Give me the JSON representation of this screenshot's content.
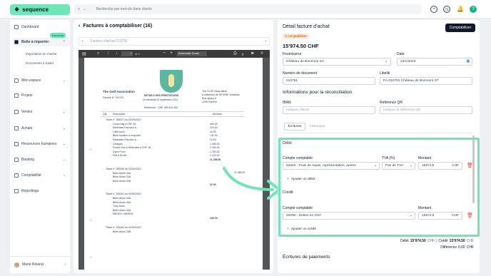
{
  "topbar": {
    "brand": "sequence",
    "search_placeholder": "Recherche par mot-clé dans clients"
  },
  "sidebar": {
    "items": [
      {
        "label": "Dashboard"
      },
      {
        "label": "Boîte à importer"
      },
      {
        "label": "Mon espace"
      },
      {
        "label": "Projets"
      },
      {
        "label": "Ventes"
      },
      {
        "label": "Achats"
      },
      {
        "label": "Ressources humaines"
      },
      {
        "label": "Banking"
      },
      {
        "label": "Comptabilité"
      },
      {
        "label": "Reportings"
      }
    ],
    "badge": "Nouveau",
    "subitems": [
      "Importation en masse",
      "Documents à traiter"
    ],
    "user": "Marie Roland"
  },
  "middle": {
    "title": "Factures à comptabiliser (16)",
    "file_selector": "Facture d'achat 010791",
    "toolbar": {
      "page": "1",
      "of": "of 2",
      "zoom": "Automatic Zoom"
    },
    "pdf": {
      "from": "The Golf Association",
      "invoice": "Facture N° 010791",
      "details_title": "DETAILS DES PRESTATIONS",
      "details_date": "Le vendredi 02 septembre 2022",
      "reference": "Référence : CHE-396.324.352",
      "to_lines": [
        "The GLOF Association",
        "A l'attention de SPORRI Jonathan",
        "Rue Appuy 6",
        "1208 Genève"
      ],
      "cols": [
        "Qte",
        "Description",
        "Montant"
      ],
      "rows": [
        {
          "desc": "Ticket n° 283371 du 02/09/2022",
          "amount": ""
        },
        {
          "desc": "Lunch bag à CHF 45",
          "amount": "450.00"
        },
        {
          "desc": "Minérales Pannaux à ...",
          "amount": "224.00"
        },
        {
          "desc": "Café lunch",
          "amount": "16.00"
        },
        {
          "desc": "Bière location à emporter",
          "amount": "132.00"
        },
        {
          "desc": "Minérales Pannaux à ...",
          "amount": "12.00"
        },
        {
          "desc": "Canapés",
          "amount": "1 080.00"
        },
        {
          "desc": "Forfait Vins & Minérales à CHF 18...",
          "amount": "1 260.00"
        },
        {
          "desc": "Open Food",
          "amount": "1 260.00"
        },
        {
          "desc": "FMI à Pa 86...",
          "amount": "1 120.00"
        },
        {
          "desc": "",
          "amount": "11 288.00"
        },
        {
          "desc": "Ticket n° 283390 du 02/09/2022",
          "amount": ""
        },
        {
          "desc": "Bière Artois 33cl",
          "amount": ""
        },
        {
          "desc": "Bière Artois 33cl",
          "amount": ""
        },
        {
          "desc": "Bière Artois 33cl",
          "amount": ""
        },
        {
          "desc": "",
          "amount": "31.00"
        },
        {
          "desc": "Ticket n° 283391 du 02/09/2022",
          "amount": ""
        },
        {
          "desc": "Bière Artois 33cl",
          "amount": ""
        },
        {
          "desc": "Bière Artois 33cl",
          "amount": ""
        },
        {
          "desc": "Trois Dans",
          "amount": ""
        },
        {
          "desc": "Bière Artois 33cl",
          "amount": ""
        },
        {
          "desc": "MERES / BIERES",
          "amount": ""
        },
        {
          "desc": "",
          "amount": "150.00"
        },
        {
          "desc": "Ticket n° 283393 du 02/09/2022",
          "amount": ""
        },
        {
          "desc": "Bière Artois 33cl",
          "amount": ""
        }
      ],
      "side_total": "11 288.00"
    }
  },
  "right": {
    "title": "Détail facture d'achat",
    "button": "Comptabiliser",
    "status": "À comptabiliser",
    "amount": "15'974.50 CHF",
    "fournisseur_label": "Fournisseur",
    "fournisseur": "Château de Bonmont SA",
    "date_label": "Date",
    "date": "23/1/2023",
    "numero_label": "Numéro de document",
    "numero": "010791",
    "libelle_label": "Libellé",
    "libelle": "FA-010791 Château de Bonmont ST",
    "recon_title": "Informations pour la réconciliation",
    "iban_label": "IBAN",
    "iban_ph": "Indiquer l'IBAN",
    "refqr_label": "Référence QR",
    "refqr_ph": "Indiquer la référence QR",
    "tabs": [
      "Écritures",
      "Historique"
    ],
    "debit": {
      "title": "Débit",
      "compte_label": "Compte comptable",
      "tva_label": "TVA (%)",
      "montant_label": "Montant",
      "compte": "52820 - Frais de repas, représentation, autres",
      "tva": "Pas de TVA",
      "montant": "15974,5",
      "currency": "CHF",
      "add": "Ajouter un débit"
    },
    "credit": {
      "title": "Crédit",
      "compte_label": "Compte comptable",
      "montant_label": "Montant",
      "compte": "20000 - Dettes en CHF",
      "montant": "15974,5",
      "currency": "CHF",
      "add": "Ajouter un crédit"
    },
    "summary": {
      "debit_label": "Débit",
      "debit": "15'974.50",
      "debit_cur": "CHF",
      "credit_label": "Crédit",
      "credit": "15'974.50",
      "credit_cur": "CHF",
      "diff_label": "Différence",
      "diff": "0.00",
      "diff_cur": "CHF"
    },
    "paiements": "Écritures de paiements"
  },
  "colors": {
    "accent": "#6ee7b7",
    "dark": "#111827"
  }
}
